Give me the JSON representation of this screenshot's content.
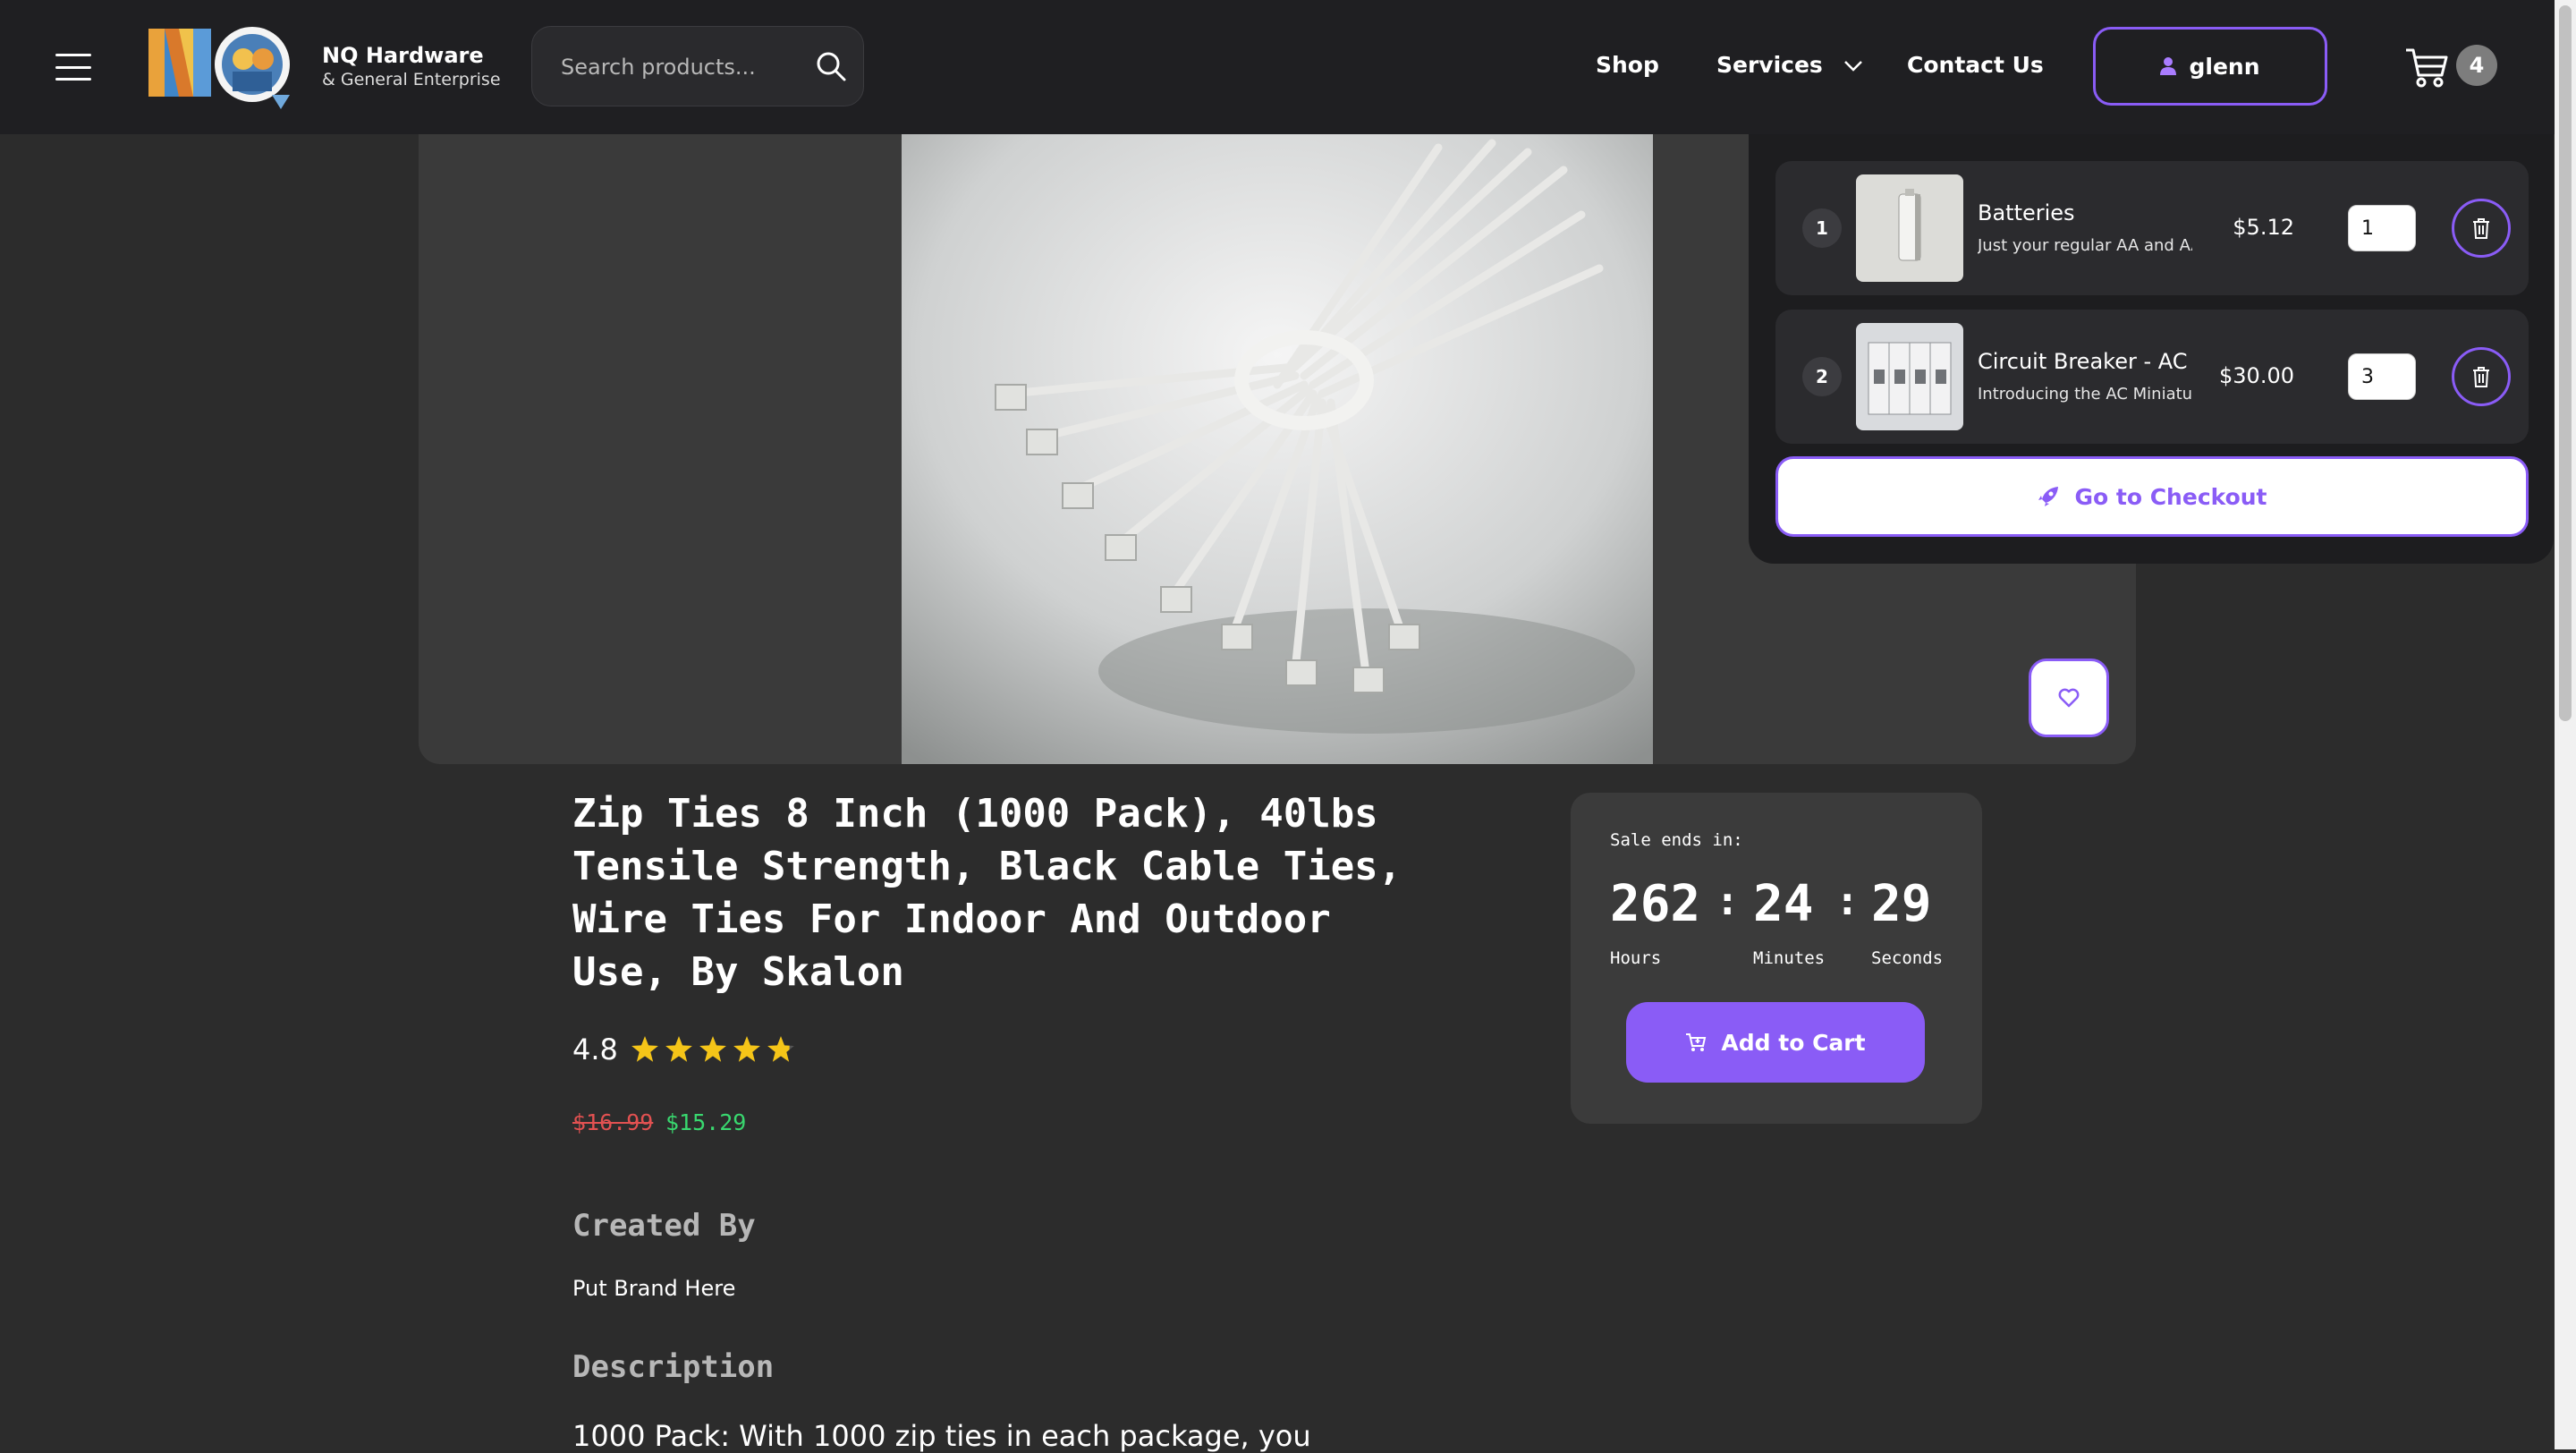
{
  "header": {
    "brand_name": "NQ Hardware",
    "brand_sub": "& General Enterprise",
    "search_placeholder": "Search products...",
    "nav": {
      "shop": "Shop",
      "services": "Services",
      "contact": "Contact Us"
    },
    "user_name": "glenn",
    "cart_count": "4"
  },
  "cart": {
    "items": [
      {
        "index": "1",
        "name": "Batteries",
        "desc": "Just your regular AA and AAA batteries",
        "price": "$5.12",
        "qty": "1"
      },
      {
        "index": "2",
        "name": "Circuit Breaker - AC",
        "desc": "Introducing the AC Miniature Circuit Breaker",
        "price": "$30.00",
        "qty": "3"
      }
    ],
    "checkout_label": "Go to Checkout"
  },
  "product": {
    "title": "Zip Ties 8 Inch (1000 Pack), 40lbs Tensile Strength, Black Cable Ties, Wire Ties For Indoor And Outdoor Use, By Skalon",
    "rating": "4.8",
    "rating_value": 4.8,
    "old_price": "$16.99",
    "new_price": "$15.29",
    "created_by_heading": "Created By",
    "brand": "Put Brand Here",
    "description_heading": "Description",
    "description": "1000 Pack: With 1000 zip ties in each package, you"
  },
  "sale": {
    "label": "Sale ends in:",
    "hours": "262",
    "minutes": "24",
    "seconds": "29",
    "hours_label": "Hours",
    "minutes_label": "Minutes",
    "seconds_label": "Seconds",
    "separator": ":",
    "add_to_cart": "Add to Cart"
  },
  "colors": {
    "accent": "#8a5cf6",
    "old_price": "#e25151",
    "new_price": "#39d86f",
    "star": "#f5c518"
  }
}
